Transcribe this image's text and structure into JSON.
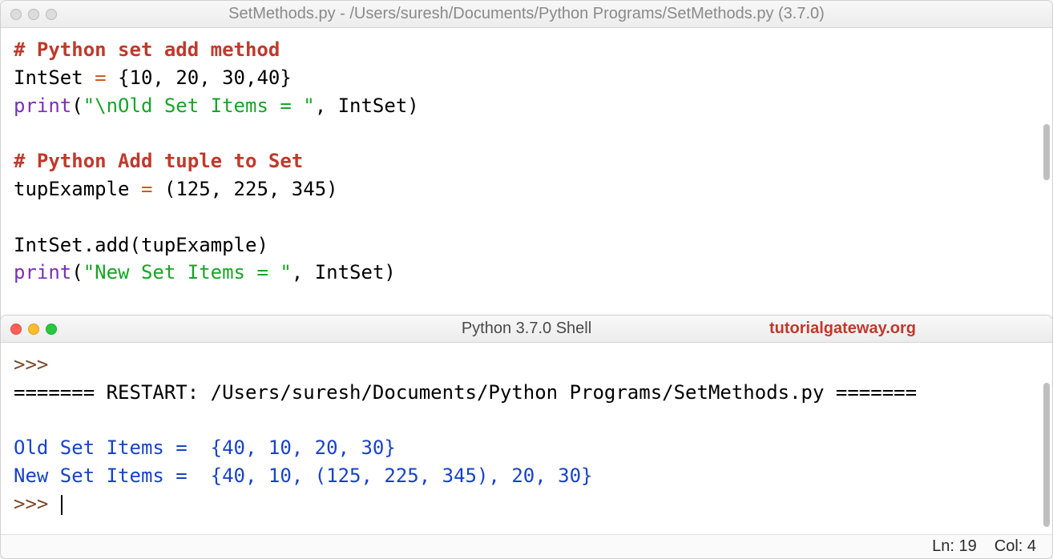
{
  "editor": {
    "title": "SetMethods.py - /Users/suresh/Documents/Python Programs/SetMethods.py (3.7.0)",
    "code": {
      "l1_comment": "# Python set add method",
      "l2_ident": "IntSet",
      "l2_eq": " = ",
      "l2_brace_open": "{",
      "l2_vals": "10, 20, 30,40",
      "l2_brace_close": "}",
      "l3_print": "print",
      "l3_open": "(",
      "l3_str": "\"\\nOld Set Items = \"",
      "l3_mid": ", IntSet",
      "l3_close": ")",
      "l5_comment": "# Python Add tuple to Set",
      "l6_ident": "tupExample",
      "l6_eq": " = ",
      "l6_open": "(",
      "l6_vals": "125, 225, 345",
      "l6_close": ")",
      "l8_lhs": "IntSet.add",
      "l8_open": "(",
      "l8_arg": "tupExample",
      "l8_close": ")",
      "l9_print": "print",
      "l9_open": "(",
      "l9_str": "\"New Set Items = \"",
      "l9_mid": ", IntSet",
      "l9_close": ")"
    }
  },
  "shell": {
    "title": "Python 3.7.0 Shell",
    "watermark": "tutorialgateway.org",
    "prompt": ">>>",
    "restart_line": "======= RESTART: /Users/suresh/Documents/Python Programs/SetMethods.py =======",
    "out1": "Old Set Items =  {40, 10, 20, 30}",
    "out2": "New Set Items =  {40, 10, (125, 225, 345), 20, 30}",
    "status_ln": "Ln: 19",
    "status_col": "Col: 4"
  }
}
